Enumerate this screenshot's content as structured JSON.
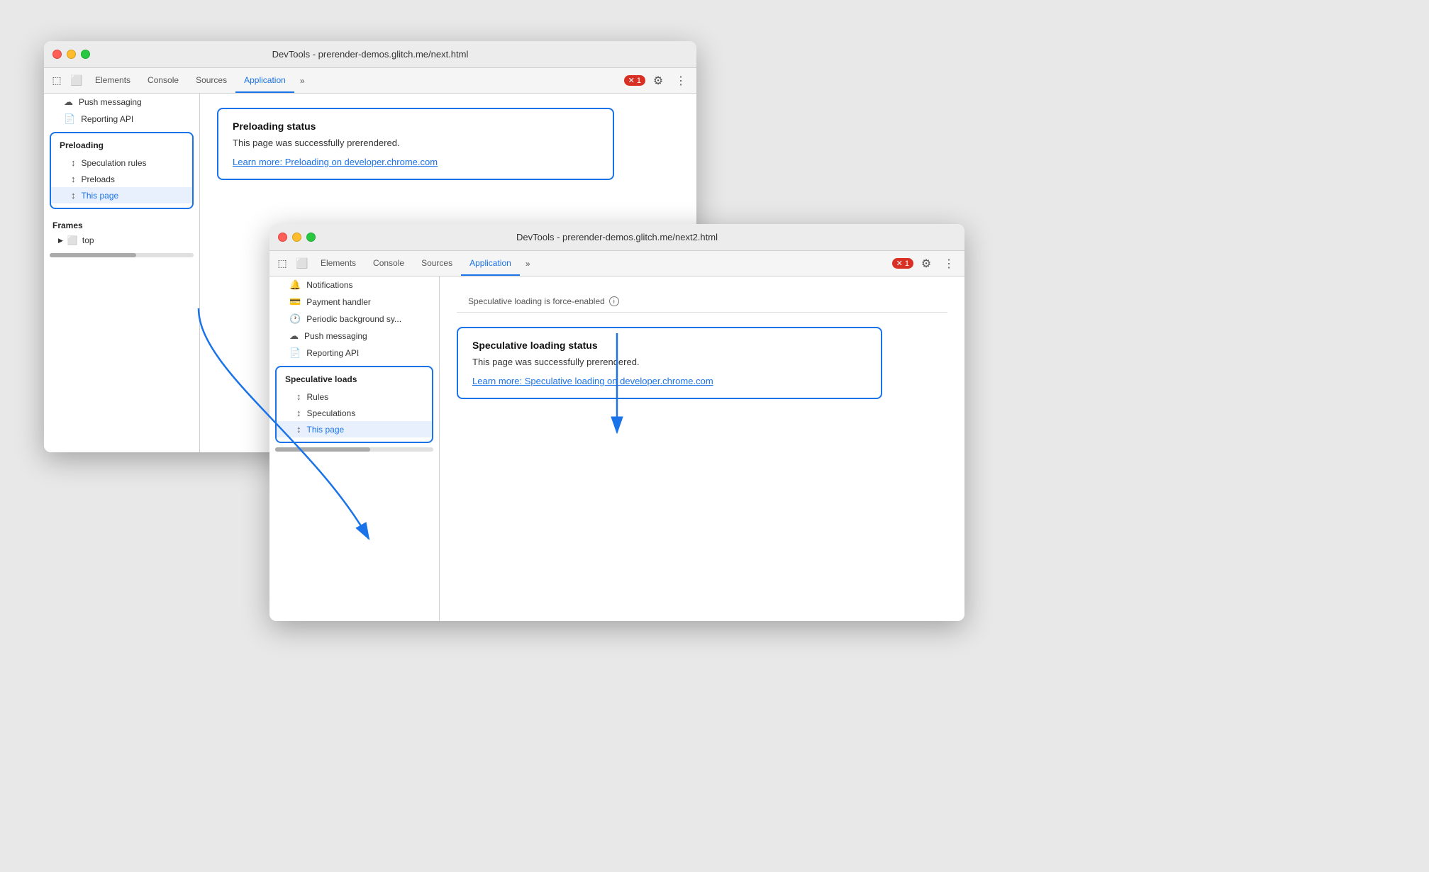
{
  "colors": {
    "blue": "#1a73e8",
    "selected_bg": "#e8f0fe",
    "error_red": "#d93025"
  },
  "window1": {
    "title": "DevTools - prerender-demos.glitch.me/next.html",
    "tabs": [
      "Elements",
      "Console",
      "Sources",
      "Application"
    ],
    "active_tab": "Application",
    "error_count": "1",
    "sidebar": {
      "push_messaging": "Push messaging",
      "reporting_api": "Reporting API",
      "preloading_label": "Preloading",
      "speculation_rules": "Speculation rules",
      "preloads": "Preloads",
      "this_page": "This page",
      "frames_label": "Frames",
      "top_label": "top"
    },
    "main": {
      "status_title": "Preloading status",
      "status_text": "This page was successfully prerendered.",
      "status_link": "Learn more: Preloading on developer.chrome.com"
    }
  },
  "window2": {
    "title": "DevTools - prerender-demos.glitch.me/next2.html",
    "tabs": [
      "Elements",
      "Console",
      "Sources",
      "Application"
    ],
    "active_tab": "Application",
    "error_count": "1",
    "force_enabled_text": "Speculative loading is force-enabled",
    "sidebar": {
      "notifications": "Notifications",
      "payment_handler": "Payment handler",
      "periodic_background": "Periodic background sy...",
      "push_messaging": "Push messaging",
      "reporting_api": "Reporting API",
      "spec_loads_label": "Speculative loads",
      "rules": "Rules",
      "speculations": "Speculations",
      "this_page": "This page"
    },
    "main": {
      "status_title": "Speculative loading status",
      "status_text": "This page was successfully prerendered.",
      "status_link": "Learn more: Speculative loading on developer.chrome.com"
    }
  },
  "icons": {
    "close": "●",
    "minimize": "●",
    "maximize": "●",
    "cursor": "⬚",
    "device": "⬚",
    "overflow": "»",
    "gear": "⚙",
    "dots": "⋮",
    "push": "☁",
    "document": "📄",
    "arrows_ud": "↕",
    "folder": "🗂",
    "chevron_right": "▶",
    "payment": "💳",
    "clock": "🕐",
    "frame_icon": "⬜"
  }
}
